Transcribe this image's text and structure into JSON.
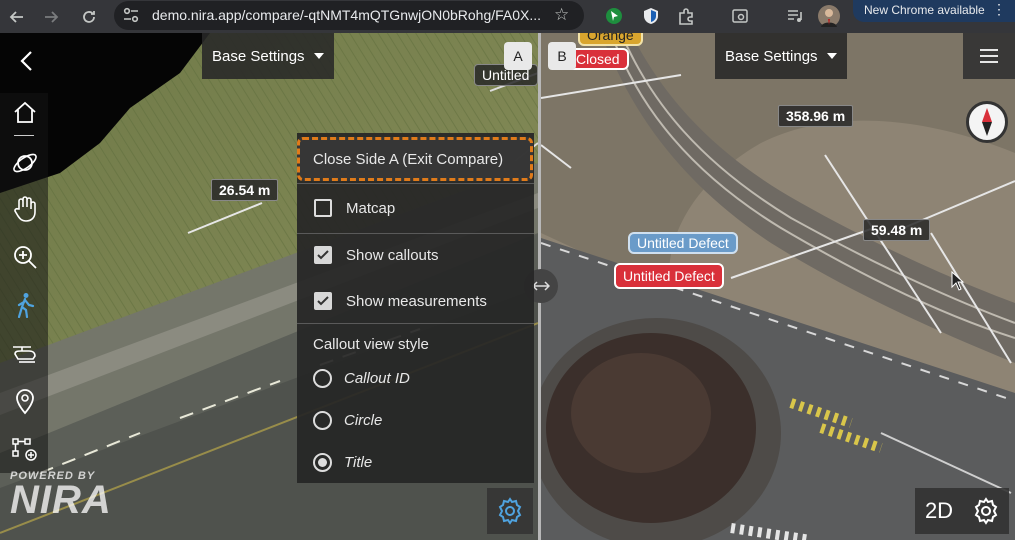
{
  "browser": {
    "url": "demo.nira.app/compare/-qtNMT4mQTGnwjON0bRohg/FA0X...",
    "new_chrome_label": "New Chrome available",
    "icons": [
      "back-arrow-icon",
      "forward-arrow-icon",
      "reload-icon",
      "site-settings-icon",
      "bookmark-star-icon",
      "extension-icon",
      "shield-extension-icon",
      "puzzle-icon",
      "tab-search-icon",
      "media-icon",
      "profile-avatar",
      "kebab-menu-icon"
    ]
  },
  "left_panel": {
    "base_settings_label": "Base Settings",
    "side_tag": "A",
    "measurement_label": "26.54 m",
    "callout_partial": "Untitled",
    "toolbar_icons": [
      "home-icon",
      "orbit-icon",
      "pan-hand-icon",
      "zoom-icon",
      "walk-icon",
      "fly-drone-icon",
      "location-pin-icon",
      "annotate-icon"
    ],
    "logo_top": "POWERED BY",
    "logo_main": "NIRA"
  },
  "settings_menu": {
    "exit_compare_label": "Close Side A (Exit Compare)",
    "matcap_label": "Matcap",
    "matcap_checked": false,
    "show_callouts_label": "Show callouts",
    "show_callouts_checked": true,
    "show_measurements_label": "Show measurements",
    "show_measurements_checked": true,
    "callout_style_heading": "Callout view style",
    "options": [
      {
        "label": "Callout ID",
        "selected": false
      },
      {
        "label": "Circle",
        "selected": false
      },
      {
        "label": "Title",
        "selected": true
      }
    ],
    "gear_color": "#4fa3e0"
  },
  "right_panel": {
    "base_settings_label": "Base Settings",
    "side_tag": "B",
    "orange_label": "Orange",
    "closed_label": "Closed",
    "measurement_1": "358.96 m",
    "measurement_2": "59.48 m",
    "callout_blue": "Untitled Defect",
    "callout_red": "Untitled Defect",
    "btn_2d": "2D"
  },
  "colors": {
    "accent_orange": "#e07b1a",
    "callout_red": "#d9303a",
    "callout_blue": "#6a9bc9"
  }
}
